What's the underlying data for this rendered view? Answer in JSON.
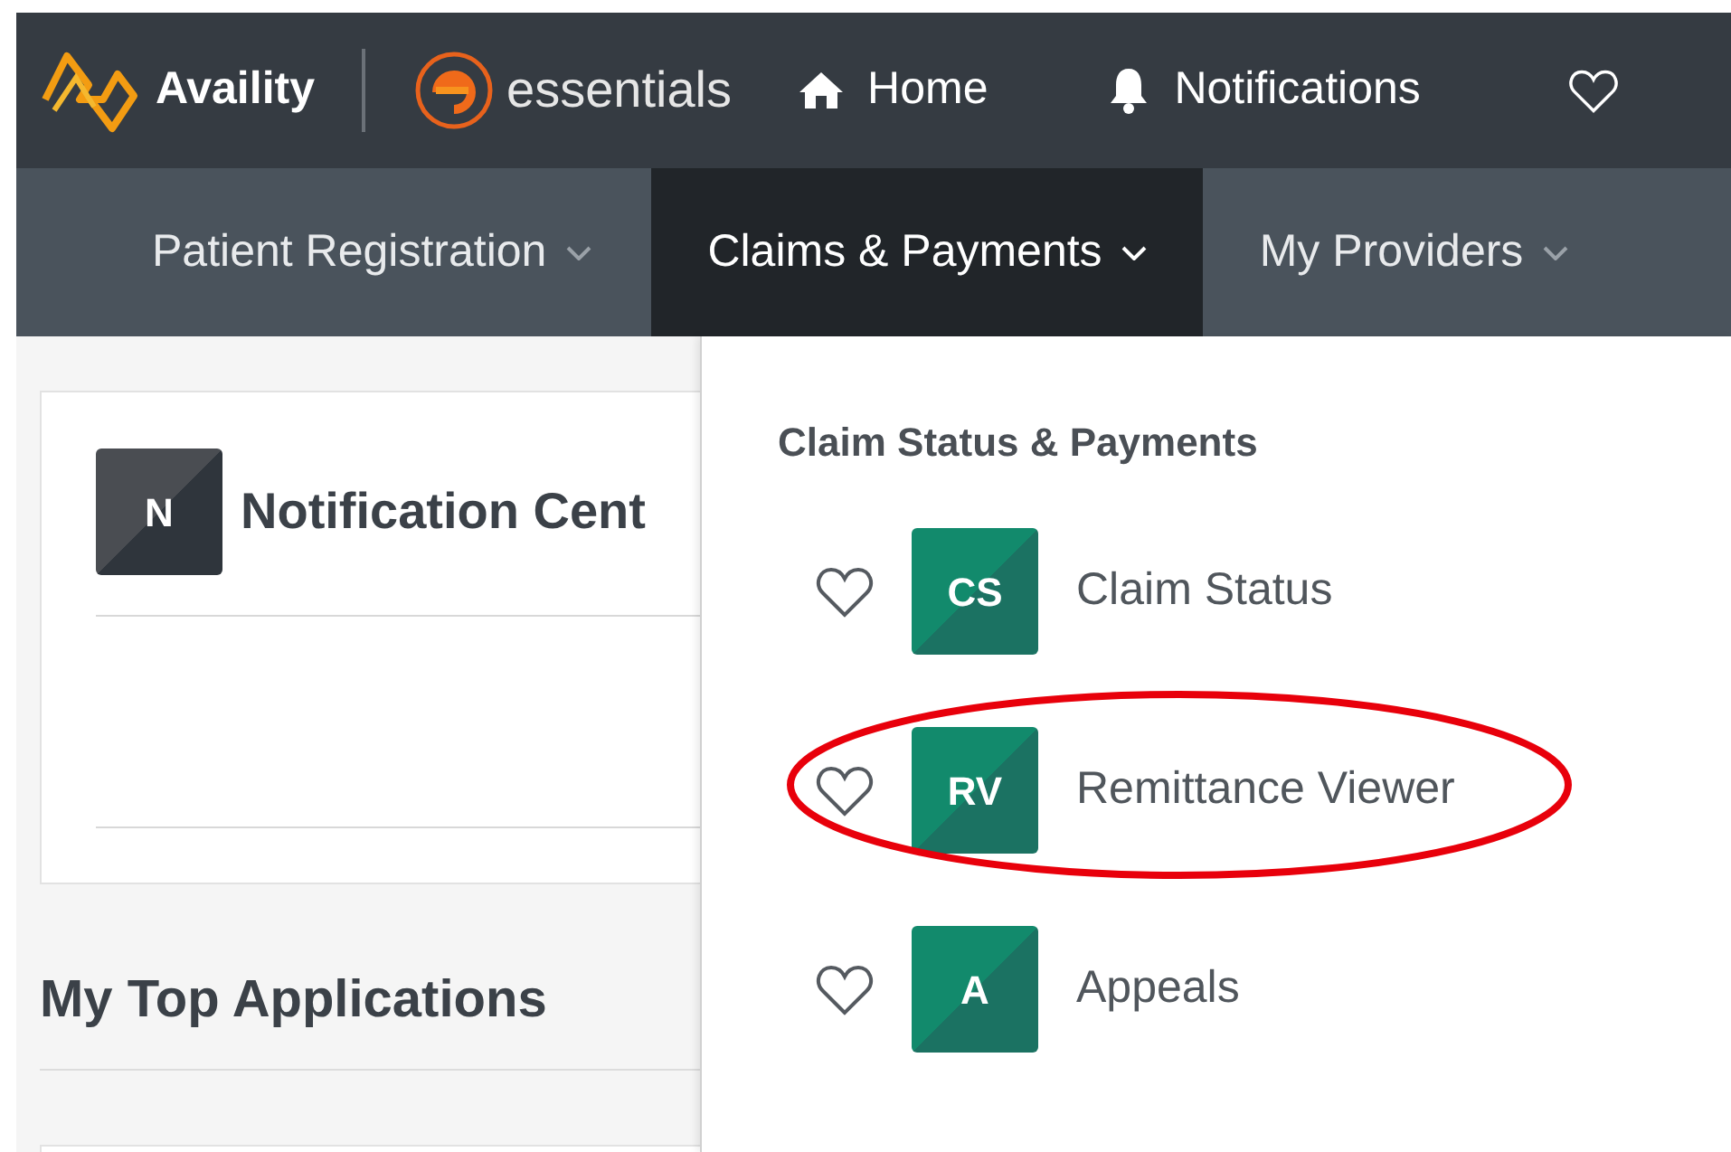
{
  "top_bar": {
    "brand": "Availity",
    "product": "essentials",
    "links": [
      {
        "label": "Home",
        "kind": "home"
      },
      {
        "label": "Notifications",
        "kind": "bell"
      }
    ]
  },
  "nav": {
    "tabs": [
      {
        "label": "Patient Registration",
        "selected": false
      },
      {
        "label": "Claims & Payments",
        "selected": true
      },
      {
        "label": "My Providers",
        "selected": false
      }
    ]
  },
  "notification_card": {
    "tile": "N",
    "title": "Notification Cent"
  },
  "top_applications": {
    "title": "My Top Applications"
  },
  "dropdown": {
    "heading": "Claim Status & Payments",
    "items": [
      {
        "tile": "CS",
        "label": "Claim Status",
        "favorite": false,
        "highlighted": false
      },
      {
        "tile": "RV",
        "label": "Remittance Viewer",
        "favorite": false,
        "highlighted": true
      },
      {
        "tile": "A",
        "label": "Appeals",
        "favorite": false,
        "highlighted": false
      }
    ]
  }
}
